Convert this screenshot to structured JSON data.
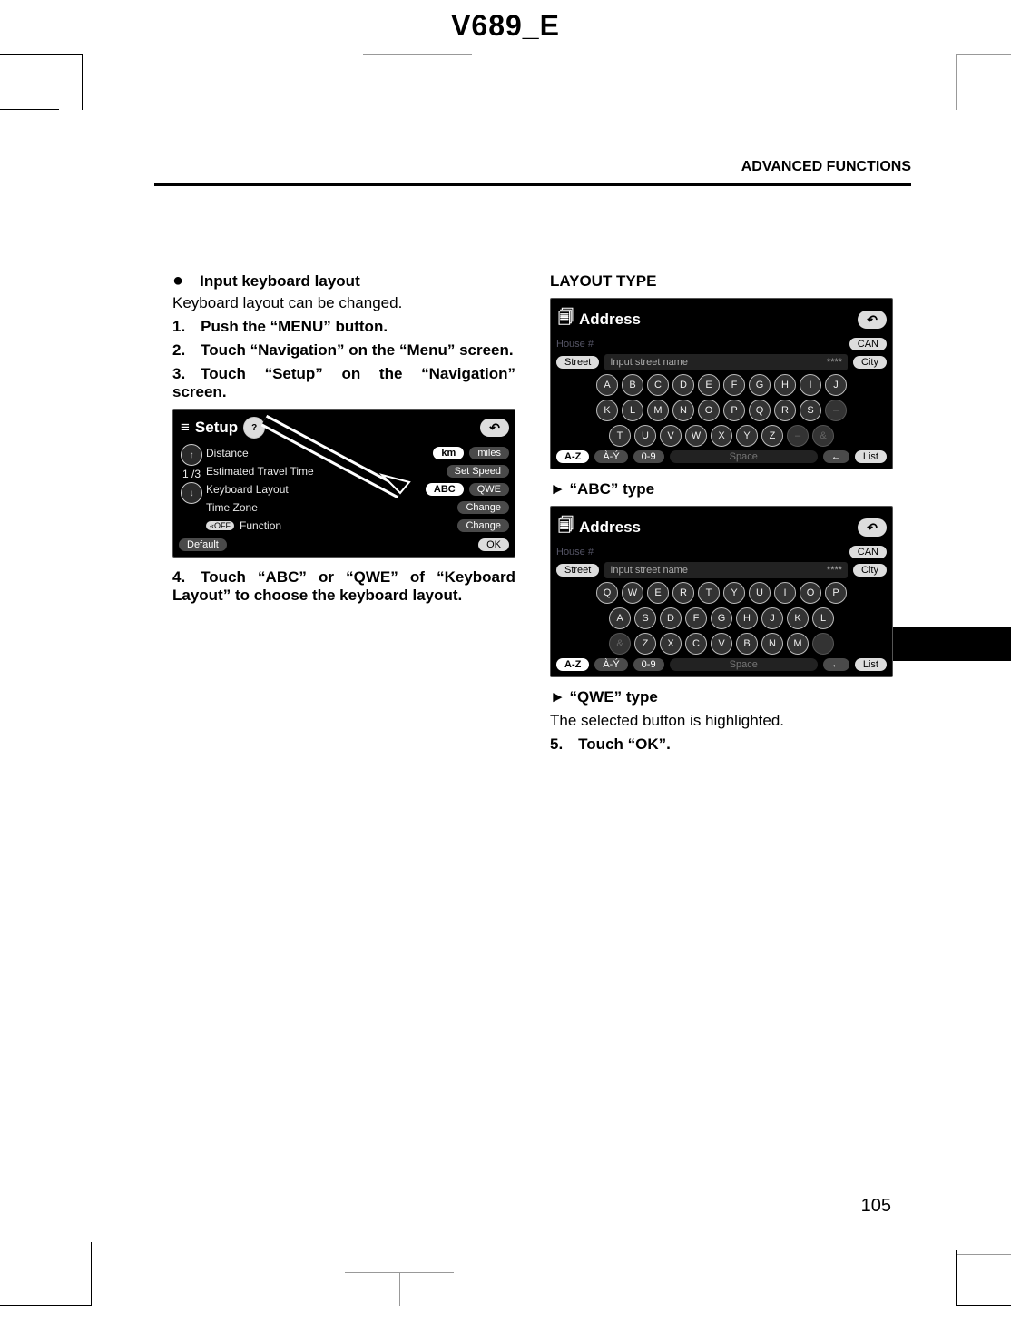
{
  "doc_header": "V689_E",
  "running_head": "ADVANCED FUNCTIONS",
  "page_number": "105",
  "left_col": {
    "bullet_heading": "Input keyboard layout",
    "intro": "Keyboard layout can be changed.",
    "step1": "1. Push the “MENU” button.",
    "step2": "2. Touch “Navigation” on the “Menu” screen.",
    "step3": "3. Touch “Setup” on the “Navigation” screen.",
    "step4": "4. Touch “ABC” or “QWE” of “Keyboard Layout” to choose the keyboard layout."
  },
  "right_col": {
    "layout_heading": "LAYOUT TYPE",
    "abc_type": "► “ABC” type",
    "qwe_type": "► “QWE” type",
    "highlight_note": "The selected button is highlighted.",
    "step5": "5. Touch “OK”."
  },
  "setup_screen": {
    "title": "Setup",
    "help_icon": "?",
    "back_icon": "↶",
    "up_icon": "↑",
    "down_icon": "↓",
    "page_ind": "1 /3",
    "rows": {
      "distance": "Distance",
      "km": "km",
      "miles": "miles",
      "eta": "Estimated Travel Time",
      "setspeed": "Set Speed",
      "kbd": "Keyboard Layout",
      "abc": "ABC",
      "qwe": "QWE",
      "tz": "Time Zone",
      "change1": "Change",
      "off": "«OFF",
      "func": "Function",
      "change2": "Change"
    },
    "default": "Default",
    "ok": "OK"
  },
  "addr_screen": {
    "title": "Address",
    "back_icon": "↶",
    "house": "House #",
    "can": "CAN",
    "street_btn": "Street",
    "street_ph": "Input street name",
    "stars": "****",
    "city": "City",
    "az": "A-Z",
    "ay": "À-Ý",
    "num09": "0-9",
    "space": "Space",
    "bsp": "←",
    "list": "List",
    "amp": "&",
    "dash": "–"
  },
  "keys_abc": {
    "r1": [
      "A",
      "B",
      "C",
      "D",
      "E",
      "F",
      "G",
      "H",
      "I",
      "J"
    ],
    "r2": [
      "K",
      "L",
      "M",
      "N",
      "O",
      "P",
      "Q",
      "R",
      "S"
    ],
    "r3": [
      "T",
      "U",
      "V",
      "W",
      "X",
      "Y",
      "Z"
    ]
  },
  "keys_qwe": {
    "r1": [
      "Q",
      "W",
      "E",
      "R",
      "T",
      "Y",
      "U",
      "I",
      "O",
      "P"
    ],
    "r2": [
      "A",
      "S",
      "D",
      "F",
      "G",
      "H",
      "J",
      "K",
      "L"
    ],
    "r3": [
      "Z",
      "X",
      "C",
      "V",
      "B",
      "N",
      "M"
    ]
  }
}
